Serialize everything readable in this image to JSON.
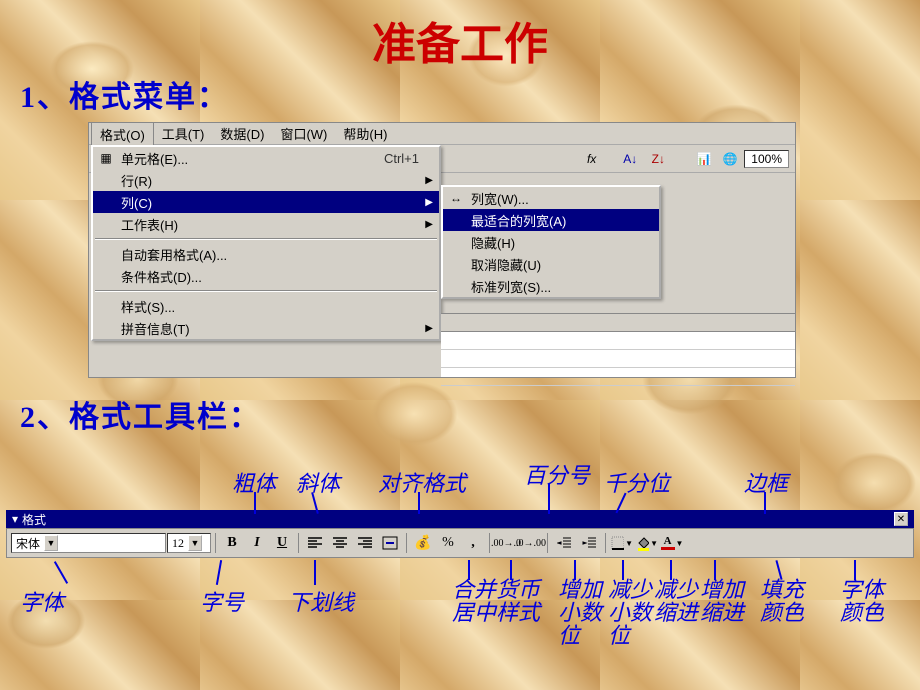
{
  "slide": {
    "title": "准备工作",
    "section1": "1、格式菜单：",
    "section2": "2、格式工具栏："
  },
  "menubar": {
    "format": "格式(O)",
    "tools": "工具(T)",
    "data": "数据(D)",
    "window": "窗口(W)",
    "help": "帮助(H)"
  },
  "toolbar_top": {
    "zoom": "100%",
    "fx": "fx"
  },
  "format_menu": {
    "cells": "单元格(E)...",
    "cells_shortcut": "Ctrl+1",
    "row": "行(R)",
    "column": "列(C)",
    "sheet": "工作表(H)",
    "autoformat": "自动套用格式(A)...",
    "conditional": "条件格式(D)...",
    "style": "样式(S)...",
    "phonetic": "拼音信息(T)"
  },
  "column_submenu": {
    "width": "列宽(W)...",
    "autofit": "最适合的列宽(A)",
    "hide": "隐藏(H)",
    "unhide": "取消隐藏(U)",
    "standard": "标准列宽(S)..."
  },
  "format_toolbar": {
    "title": "格式",
    "font_name": "宋体",
    "font_size": "12",
    "bold": "B",
    "italic": "I",
    "underline": "U",
    "percent": "%",
    "comma": ",",
    "currency": "¥",
    "font_color_letter": "A"
  },
  "callouts": {
    "font": "字体",
    "size": "字号",
    "bold": "粗体",
    "italic": "斜体",
    "underline": "下划线",
    "align": "对齐格式",
    "merge": "合并居中",
    "currency": "货币样式",
    "percent": "百分号",
    "thousand": "千分位",
    "inc_dec": "增加小数位",
    "dec_dec": "减少小数位",
    "indent_dec": "减少缩进",
    "indent_inc": "增加缩进",
    "border": "边框",
    "fill": "填充颜色",
    "fontcolor": "字体颜色"
  }
}
